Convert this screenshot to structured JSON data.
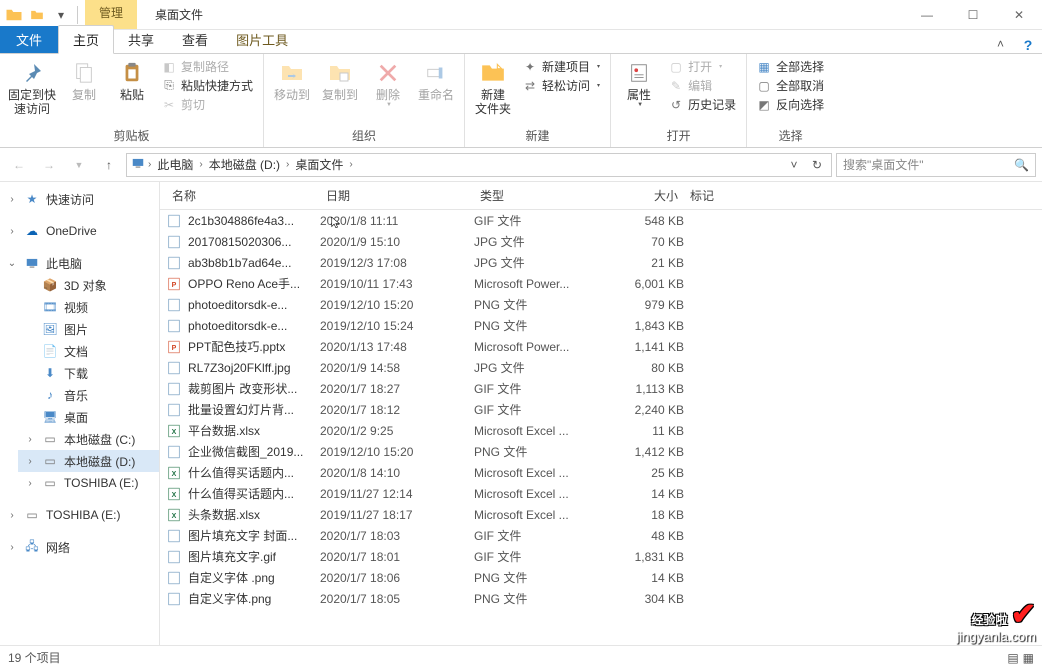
{
  "title": "桌面文件",
  "context_tab": "管理",
  "tabs": {
    "file": "文件",
    "home": "主页",
    "share": "共享",
    "view": "查看",
    "tool": "图片工具"
  },
  "ribbon": {
    "clipboard": {
      "pin": "固定到快\n速访问",
      "copy": "复制",
      "paste": "粘贴",
      "cut": "剪切",
      "copy_path": "复制路径",
      "paste_shortcut": "粘贴快捷方式",
      "label": "剪贴板"
    },
    "organize": {
      "move": "移动到",
      "copy_to": "复制到",
      "delete": "删除",
      "rename": "重命名",
      "label": "组织"
    },
    "new": {
      "folder": "新建\n文件夹",
      "new_item": "新建项目",
      "easy_access": "轻松访问",
      "label": "新建"
    },
    "open": {
      "props": "属性",
      "open": "打开",
      "edit": "编辑",
      "history": "历史记录",
      "label": "打开"
    },
    "select": {
      "all": "全部选择",
      "none": "全部取消",
      "invert": "反向选择",
      "label": "选择"
    }
  },
  "breadcrumb": {
    "pc": "此电脑",
    "drive": "本地磁盘 (D:)",
    "folder": "桌面文件"
  },
  "search_placeholder": "搜索\"桌面文件\"",
  "sidebar": {
    "quick": "快速访问",
    "onedrive": "OneDrive",
    "pc": "此电脑",
    "pc_children": [
      "3D 对象",
      "视频",
      "图片",
      "文档",
      "下载",
      "音乐",
      "桌面",
      "本地磁盘 (C:)",
      "本地磁盘 (D:)",
      "TOSHIBA (E:)"
    ],
    "toshiba": "TOSHIBA (E:)",
    "network": "网络"
  },
  "columns": {
    "name": "名称",
    "date": "日期",
    "type": "类型",
    "size": "大小",
    "tag": "标记"
  },
  "files": [
    {
      "icon": "gif",
      "name": "2c1b304886fe4a3...",
      "date": "2020/1/8 11:11",
      "type": "GIF 文件",
      "size": "548 KB"
    },
    {
      "icon": "jpg",
      "name": "20170815020306...",
      "date": "2020/1/9 15:10",
      "type": "JPG 文件",
      "size": "70 KB"
    },
    {
      "icon": "jpg",
      "name": "ab3b8b1b7ad64e...",
      "date": "2019/12/3 17:08",
      "type": "JPG 文件",
      "size": "21 KB"
    },
    {
      "icon": "pptx",
      "name": "OPPO Reno Ace手...",
      "date": "2019/10/11 17:43",
      "type": "Microsoft Power...",
      "size": "6,001 KB"
    },
    {
      "icon": "png",
      "name": "photoeditorsdk-e...",
      "date": "2019/12/10 15:20",
      "type": "PNG 文件",
      "size": "979 KB"
    },
    {
      "icon": "png",
      "name": "photoeditorsdk-e...",
      "date": "2019/12/10 15:24",
      "type": "PNG 文件",
      "size": "1,843 KB"
    },
    {
      "icon": "pptx",
      "name": "PPT配色技巧.pptx",
      "date": "2020/1/13 17:48",
      "type": "Microsoft Power...",
      "size": "1,141 KB"
    },
    {
      "icon": "jpg",
      "name": "RL7Z3oj20FKlff.jpg",
      "date": "2020/1/9 14:58",
      "type": "JPG 文件",
      "size": "80 KB"
    },
    {
      "icon": "gif",
      "name": "裁剪图片 改变形状...",
      "date": "2020/1/7 18:27",
      "type": "GIF 文件",
      "size": "1,113 KB"
    },
    {
      "icon": "gif",
      "name": "批量设置幻灯片背...",
      "date": "2020/1/7 18:12",
      "type": "GIF 文件",
      "size": "2,240 KB"
    },
    {
      "icon": "xlsx",
      "name": "平台数据.xlsx",
      "date": "2020/1/2 9:25",
      "type": "Microsoft Excel ...",
      "size": "11 KB"
    },
    {
      "icon": "png",
      "name": "企业微信截图_2019...",
      "date": "2019/12/10 15:20",
      "type": "PNG 文件",
      "size": "1,412 KB"
    },
    {
      "icon": "xlsx",
      "name": "什么值得买话题内...",
      "date": "2020/1/8 14:10",
      "type": "Microsoft Excel ...",
      "size": "25 KB"
    },
    {
      "icon": "xlsx",
      "name": "什么值得买话题内...",
      "date": "2019/11/27 12:14",
      "type": "Microsoft Excel ...",
      "size": "14 KB"
    },
    {
      "icon": "xlsx",
      "name": "头条数据.xlsx",
      "date": "2019/11/27 18:17",
      "type": "Microsoft Excel ...",
      "size": "18 KB"
    },
    {
      "icon": "gif",
      "name": "图片填充文字 封面...",
      "date": "2020/1/7 18:03",
      "type": "GIF 文件",
      "size": "48 KB"
    },
    {
      "icon": "gif",
      "name": "图片填充文字.gif",
      "date": "2020/1/7 18:01",
      "type": "GIF 文件",
      "size": "1,831 KB"
    },
    {
      "icon": "png",
      "name": "自定义字体 .png",
      "date": "2020/1/7 18:06",
      "type": "PNG 文件",
      "size": "14 KB"
    },
    {
      "icon": "png",
      "name": "自定义字体.png",
      "date": "2020/1/7 18:05",
      "type": "PNG 文件",
      "size": "304 KB"
    }
  ],
  "status": "19 个项目",
  "watermark": {
    "brand": "经验啦",
    "url": "jingyanla.com"
  }
}
